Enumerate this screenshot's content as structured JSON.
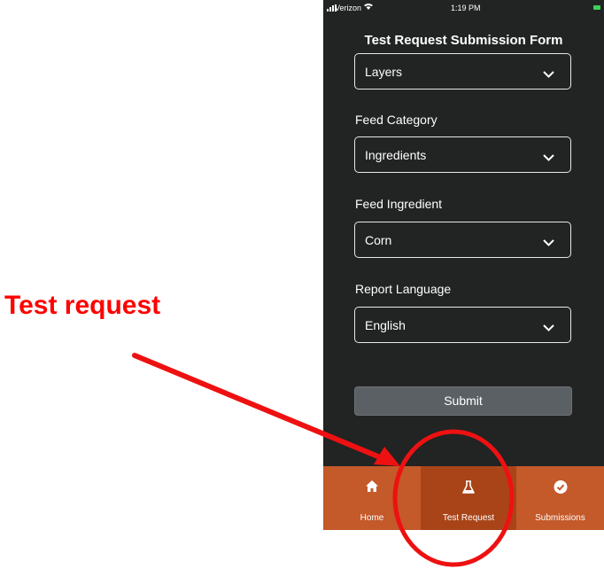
{
  "annotation": {
    "label": "Test request"
  },
  "status_bar": {
    "carrier": "Verizon",
    "time": "1:19 PM"
  },
  "header": {
    "title": "Test Request Submission Form"
  },
  "form": {
    "fields": [
      {
        "label": "",
        "value": "Layers"
      },
      {
        "label": "Feed Category",
        "value": "Ingredients"
      },
      {
        "label": "Feed Ingredient",
        "value": "Corn"
      },
      {
        "label": "Report Language",
        "value": "English"
      }
    ],
    "submit_label": "Submit"
  },
  "tabs": [
    {
      "label": "Home",
      "icon": "home-icon",
      "active": false
    },
    {
      "label": "Test Request",
      "icon": "flask-icon",
      "active": true
    },
    {
      "label": "Submissions",
      "icon": "check-circle-icon",
      "active": false
    }
  ],
  "colors": {
    "background": "#222323",
    "tab_bar": "#c4592a",
    "tab_active": "#a94418",
    "annotation": "#ff0000",
    "submit": "#5b6064"
  }
}
